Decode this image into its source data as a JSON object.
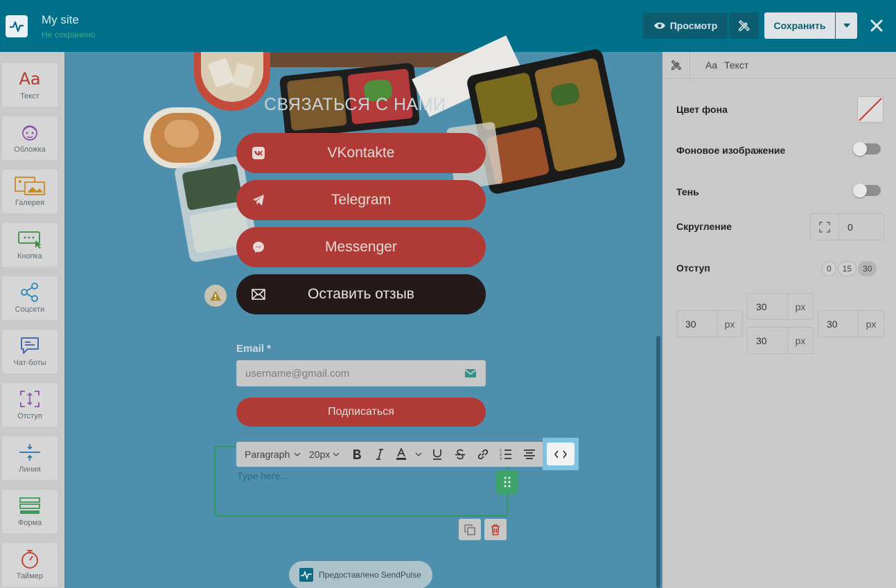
{
  "topbar": {
    "site_title": "My site",
    "site_status": "Не сохранено",
    "preview_label": "Просмотр",
    "save_label": "Сохранить"
  },
  "sidebar": {
    "items": [
      {
        "label": "Текст",
        "icon": "text-aa-icon",
        "color": "#b03a35"
      },
      {
        "label": "Обложка",
        "icon": "cover-face-icon",
        "color": "#8a52a8"
      },
      {
        "label": "Галерея",
        "icon": "gallery-icon",
        "color": "#c98a1e"
      },
      {
        "label": "Кнопка",
        "icon": "button-cursor-icon",
        "color": "#3f8c45"
      },
      {
        "label": "Соцсети",
        "icon": "share-icon",
        "color": "#2a86b5"
      },
      {
        "label": "Чат-боты",
        "icon": "chat-icon",
        "color": "#3b5fb0"
      },
      {
        "label": "Отступ",
        "icon": "spacing-icon",
        "color": "#8a52a8"
      },
      {
        "label": "Линия",
        "icon": "line-icon",
        "color": "#2a6fa0"
      },
      {
        "label": "Форма",
        "icon": "form-icon",
        "color": "#3a9a56"
      },
      {
        "label": "Таймер",
        "icon": "timer-icon",
        "color": "#c0392b"
      }
    ]
  },
  "canvas": {
    "cta_title": "СВЯЗАТЬСЯ С НАМИ",
    "social_buttons": [
      {
        "label": "VKontakte",
        "icon": "vk-icon"
      },
      {
        "label": "Telegram",
        "icon": "telegram-icon"
      },
      {
        "label": "Messenger",
        "icon": "messenger-icon"
      }
    ],
    "feedback_label": "Оставить отзыв",
    "email_label": "Email *",
    "email_placeholder": "username@gmail.com",
    "subscribe_label": "Подписаться",
    "toolbar": {
      "paragraph": "Paragraph",
      "font_size": "20px"
    },
    "type_here": "Type here...",
    "powered_by": "Предоставлено SendPulse"
  },
  "panel": {
    "crumb_text_prefix": "Aa",
    "crumb_text": "Текст",
    "bg_color_label": "Цвет фона",
    "bg_image_label": "Фоновое изображение",
    "shadow_label": "Тень",
    "radius_label": "Скругление",
    "radius_value": "0",
    "padding_label": "Отступ",
    "padding_presets": [
      "0",
      "15",
      "30"
    ],
    "padding_top": "30",
    "padding_left": "30",
    "padding_right": "30",
    "padding_bottom": "30",
    "unit": "px"
  }
}
